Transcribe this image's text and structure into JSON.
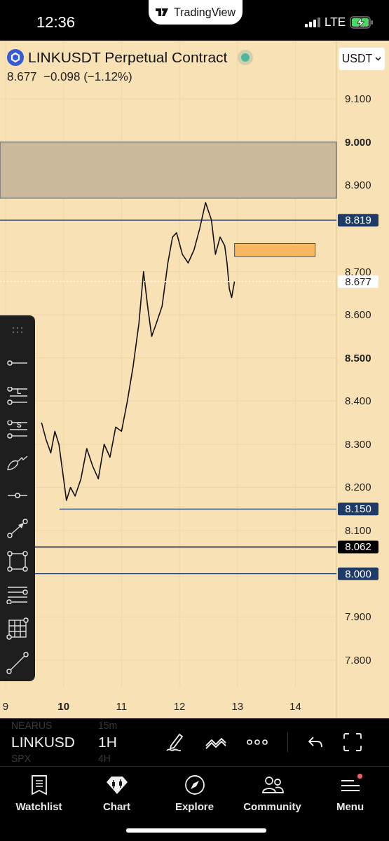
{
  "status_bar": {
    "time": "12:36",
    "app_pill": "TradingView",
    "network": "LTE"
  },
  "header": {
    "symbol": "LINKUSDT Perpetual Contract",
    "market_open": true,
    "quote": "8.677  −0.098 (−1.12%)",
    "currency": "USDT"
  },
  "drawing_tools": [
    {
      "kind": "grip"
    },
    {
      "kind": "line"
    },
    {
      "kind": "lines",
      "label": "L"
    },
    {
      "kind": "lines",
      "label": "S"
    },
    {
      "kind": "brush"
    },
    {
      "kind": "hline"
    },
    {
      "kind": "arrow"
    },
    {
      "kind": "rect"
    },
    {
      "kind": "parallel"
    },
    {
      "kind": "grid"
    },
    {
      "kind": "trend"
    }
  ],
  "chart": {
    "chart_data": {
      "type": "line",
      "grid": true,
      "xlim": [
        8.903,
        15.615
      ],
      "ylim": [
        7.665,
        9.235
      ],
      "xticks": [
        {
          "value": 9,
          "label": "9"
        },
        {
          "value": 10,
          "label": "10"
        },
        {
          "value": 11,
          "label": "11"
        },
        {
          "value": 12,
          "label": "12"
        },
        {
          "value": 13,
          "label": "13"
        },
        {
          "value": 14,
          "label": "14"
        }
      ],
      "yticks": [
        {
          "value": 9.1,
          "label": "9.100"
        },
        {
          "value": 9.0,
          "label": "9.000"
        },
        {
          "value": 8.9,
          "label": "8.900"
        },
        {
          "value": 8.7,
          "label": "8.700"
        },
        {
          "value": 8.6,
          "label": "8.600"
        },
        {
          "value": 8.5,
          "label": "8.500"
        },
        {
          "value": 8.4,
          "label": "8.400"
        },
        {
          "value": 8.3,
          "label": "8.300"
        },
        {
          "value": 8.2,
          "label": "8.200"
        },
        {
          "value": 8.1,
          "label": "8.100"
        },
        {
          "value": 7.9,
          "label": "7.900"
        },
        {
          "value": 7.8,
          "label": "7.800"
        }
      ],
      "x": [
        9.62,
        9.7,
        9.78,
        9.85,
        9.92,
        10.0,
        10.05,
        10.12,
        10.2,
        10.3,
        10.4,
        10.5,
        10.6,
        10.7,
        10.8,
        10.9,
        11.0,
        11.1,
        11.2,
        11.3,
        11.38,
        11.45,
        11.52,
        11.6,
        11.7,
        11.8,
        11.88,
        11.95,
        12.05,
        12.15,
        12.25,
        12.35,
        12.45,
        12.5,
        12.55,
        12.62,
        12.7,
        12.78,
        12.82,
        12.86,
        12.9,
        12.95
      ],
      "series": [
        {
          "color": "#111111",
          "values": [
            8.35,
            8.31,
            8.28,
            8.33,
            8.3,
            8.22,
            8.17,
            8.2,
            8.18,
            8.22,
            8.29,
            8.25,
            8.22,
            8.3,
            8.27,
            8.34,
            8.33,
            8.4,
            8.48,
            8.58,
            8.7,
            8.62,
            8.55,
            8.58,
            8.62,
            8.72,
            8.78,
            8.79,
            8.74,
            8.72,
            8.75,
            8.8,
            8.86,
            8.84,
            8.82,
            8.74,
            8.78,
            8.76,
            8.72,
            8.66,
            8.64,
            8.677
          ]
        }
      ],
      "bands": [
        {
          "axis": "y",
          "from": 8.87,
          "to": 9.0,
          "color": "#cbb99b"
        },
        {
          "axis": "y",
          "from": 8.735,
          "to": 8.765,
          "color": "#f5b860"
        }
      ],
      "ref_lines": [
        {
          "axis": "y",
          "value": 8.819,
          "label": "8.819",
          "color": "#1e3a66"
        },
        {
          "axis": "y",
          "value": 8.677,
          "label": "8.677",
          "color": "#ffffff"
        },
        {
          "axis": "y",
          "value": 8.15,
          "label": "8.150",
          "color": "#1e3a66"
        },
        {
          "axis": "y",
          "value": 8.062,
          "label": "8.062",
          "color": "#000000"
        },
        {
          "axis": "y",
          "value": 8.0,
          "label": "8.000",
          "color": "#1e3a66"
        }
      ]
    }
  },
  "bottom_toolbar": {
    "symbols": [
      {
        "label": "NEARUS",
        "selected": false
      },
      {
        "label": "LINKUSD",
        "selected": true
      },
      {
        "label": "SPX",
        "selected": false
      }
    ],
    "intervals": [
      {
        "label": "15m",
        "selected": false
      },
      {
        "label": "1H",
        "selected": true
      },
      {
        "label": "4H",
        "selected": false
      }
    ]
  },
  "tab_bar": [
    {
      "label": "Watchlist",
      "notification": false
    },
    {
      "label": "Chart",
      "notification": false
    },
    {
      "label": "Explore",
      "notification": false
    },
    {
      "label": "Community",
      "notification": false
    },
    {
      "label": "Menu",
      "notification": true
    }
  ]
}
